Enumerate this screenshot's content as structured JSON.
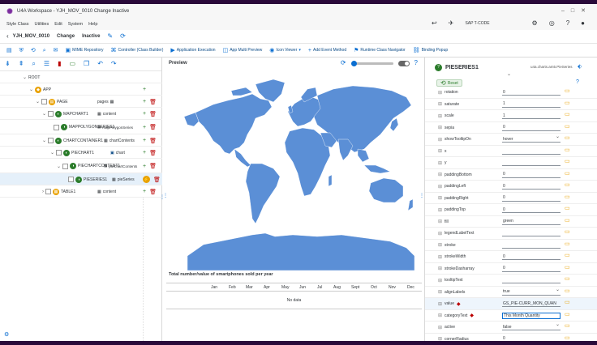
{
  "window": {
    "title": "U4A Workspace - YJH_MOV_0010 Change Inactive"
  },
  "menubar": {
    "items": [
      "Style Class",
      "Utilities",
      "Edit",
      "System",
      "Help"
    ],
    "tcode": "SAP T-CODE"
  },
  "apphead": {
    "app_id": "YJH_MOV_0010",
    "mode": "Change",
    "status": "Inactive"
  },
  "toolbar": {
    "items": [
      {
        "label": "MIME Repository",
        "icon": "folder-icon"
      },
      {
        "label": "Controller (Class Builder)",
        "icon": "code-icon"
      },
      {
        "label": "Application Execution",
        "icon": "run-icon"
      },
      {
        "label": "App Multi Preview",
        "icon": "preview-icon"
      },
      {
        "label": "Icon Viewer",
        "icon": "icon-viewer-icon"
      },
      {
        "label": "Add Event Method",
        "icon": "add-icon"
      },
      {
        "label": "Runtime Class Navigator",
        "icon": "navigator-icon"
      },
      {
        "label": "Binding Popup",
        "icon": "link-icon"
      }
    ]
  },
  "tree": {
    "rows": [
      {
        "label": "ROOT",
        "agg": "",
        "icon": ""
      },
      {
        "label": "APP",
        "agg": "",
        "icon": "app-icon"
      },
      {
        "label": "PAGE",
        "agg": "pages",
        "icon": "page-icon"
      },
      {
        "label": "MAPCHART1",
        "agg": "content",
        "icon": "chart-icon"
      },
      {
        "label": "MAPPOLYGONSERIES1",
        "agg": "mapPolygonSeries",
        "icon": "series-icon"
      },
      {
        "label": "CHARTCONTAINER1",
        "agg": "chartContents",
        "icon": "chart-icon"
      },
      {
        "label": "PIECHART1",
        "agg": "chart",
        "icon": "chart-icon"
      },
      {
        "label": "PIECHARTCONTENT1",
        "agg": "pieChartContents",
        "icon": "series-icon"
      },
      {
        "label": "PIESERIES1",
        "agg": "pieSeries",
        "icon": "series-icon"
      },
      {
        "label": "TABLE1",
        "agg": "content",
        "icon": "table-icon"
      }
    ]
  },
  "preview": {
    "title": "Preview",
    "chart_title": "Total number/value of smartphones sold per year",
    "months": [
      "Jan",
      "Feb",
      "Mar",
      "Apr",
      "May",
      "Jun",
      "Jul",
      "Aug",
      "Sept",
      "Oct",
      "Nov",
      "Dec"
    ],
    "nodata": "No data"
  },
  "props": {
    "title": "PIESERIES1",
    "library": "u4a.charts.am5.PieSeries",
    "reset_label": "Reset",
    "rows": [
      {
        "name": "rotation",
        "value": "0",
        "kind": "input"
      },
      {
        "name": "saturate",
        "value": "1",
        "kind": "input"
      },
      {
        "name": "scale",
        "value": "1",
        "kind": "input"
      },
      {
        "name": "sepia",
        "value": "0",
        "kind": "input"
      },
      {
        "name": "showTooltipOn",
        "value": "hover",
        "kind": "select"
      },
      {
        "name": "x",
        "value": "",
        "kind": "input"
      },
      {
        "name": "y",
        "value": "",
        "kind": "input"
      },
      {
        "name": "paddingBottom",
        "value": "0",
        "kind": "input"
      },
      {
        "name": "paddingLeft",
        "value": "0",
        "kind": "input"
      },
      {
        "name": "paddingRight",
        "value": "0",
        "kind": "input"
      },
      {
        "name": "paddingTop",
        "value": "0",
        "kind": "input"
      },
      {
        "name": "fill",
        "value": "green",
        "kind": "input"
      },
      {
        "name": "legendLabelText",
        "value": "",
        "kind": "input"
      },
      {
        "name": "stroke",
        "value": "",
        "kind": "input"
      },
      {
        "name": "strokeWidth",
        "value": "0",
        "kind": "input"
      },
      {
        "name": "strokeDasharray",
        "value": "0",
        "kind": "input"
      },
      {
        "name": "tooltipText",
        "value": "",
        "kind": "input"
      },
      {
        "name": "alignLabels",
        "value": "true",
        "kind": "select"
      },
      {
        "name": "value",
        "value": "GS_PIE-CURR_MON_QUAN",
        "kind": "input",
        "required": true,
        "highlight": true
      },
      {
        "name": "categoryText",
        "value": "This Month Quantity",
        "kind": "input",
        "required": true,
        "active": true
      },
      {
        "name": "active",
        "value": "false",
        "kind": "select"
      },
      {
        "name": "cornerRadius",
        "value": "0",
        "kind": "input"
      }
    ]
  },
  "colors": {
    "map_fill": "#5b8fd6",
    "accent": "#0a6ed1",
    "frame": "#2a0a3a"
  }
}
